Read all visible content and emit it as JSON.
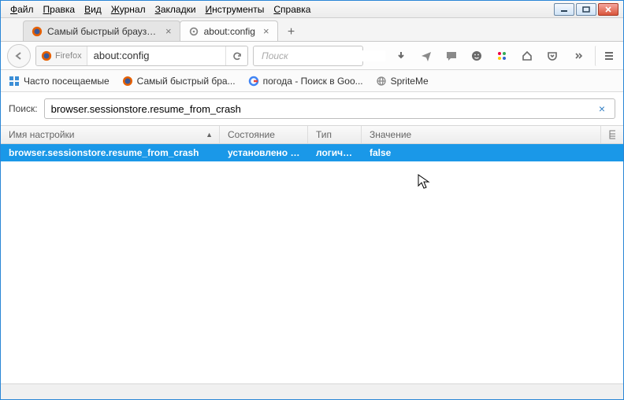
{
  "menu": [
    "Файл",
    "Правка",
    "Вид",
    "Журнал",
    "Закладки",
    "Инструменты",
    "Справка"
  ],
  "tabs": [
    {
      "label": "Самый быстрый браузер ...",
      "active": false,
      "icon": "firefox"
    },
    {
      "label": "about:config",
      "active": true,
      "icon": "gear"
    }
  ],
  "url": {
    "identity": "Firefox",
    "value": "about:config"
  },
  "search": {
    "placeholder": "Поиск"
  },
  "bookmarks": [
    {
      "label": "Часто посещаемые",
      "icon": "folder"
    },
    {
      "label": "Самый быстрый бра...",
      "icon": "firefox"
    },
    {
      "label": "погода - Поиск в Goo...",
      "icon": "google"
    },
    {
      "label": "SpriteMe",
      "icon": "globe"
    }
  ],
  "filter": {
    "label": "Поиск:",
    "value": "browser.sessionstore.resume_from_crash"
  },
  "columns": {
    "name": "Имя настройки",
    "state": "Состояние",
    "type": "Тип",
    "value": "Значение"
  },
  "rows": [
    {
      "name": "browser.sessionstore.resume_from_crash",
      "state": "установлено п...",
      "type": "логичес...",
      "value": "false"
    }
  ]
}
